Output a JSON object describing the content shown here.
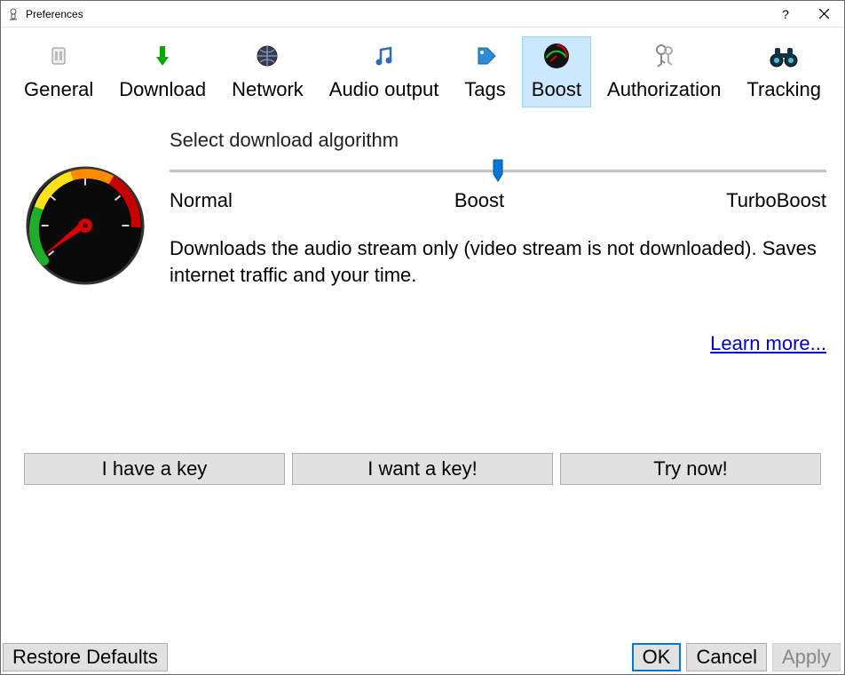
{
  "window": {
    "title": "Preferences"
  },
  "tabs": {
    "general": "General",
    "download": "Download",
    "network": "Network",
    "audio_output": "Audio output",
    "tags": "Tags",
    "boost": "Boost",
    "authorization": "Authorization",
    "tracking": "Tracking"
  },
  "boost_panel": {
    "heading": "Select download algorithm",
    "level_normal": "Normal",
    "level_boost": "Boost",
    "level_turbo": "TurboBoost",
    "description": "Downloads the audio stream only (video stream is not downloaded). Saves internet traffic and your time.",
    "learn_more": "Learn more..."
  },
  "key_buttons": {
    "have_key": "I have a key",
    "want_key": "I want a key!",
    "try_now": "Try now!"
  },
  "footer": {
    "restore": "Restore Defaults",
    "ok": "OK",
    "cancel": "Cancel",
    "apply": "Apply"
  }
}
